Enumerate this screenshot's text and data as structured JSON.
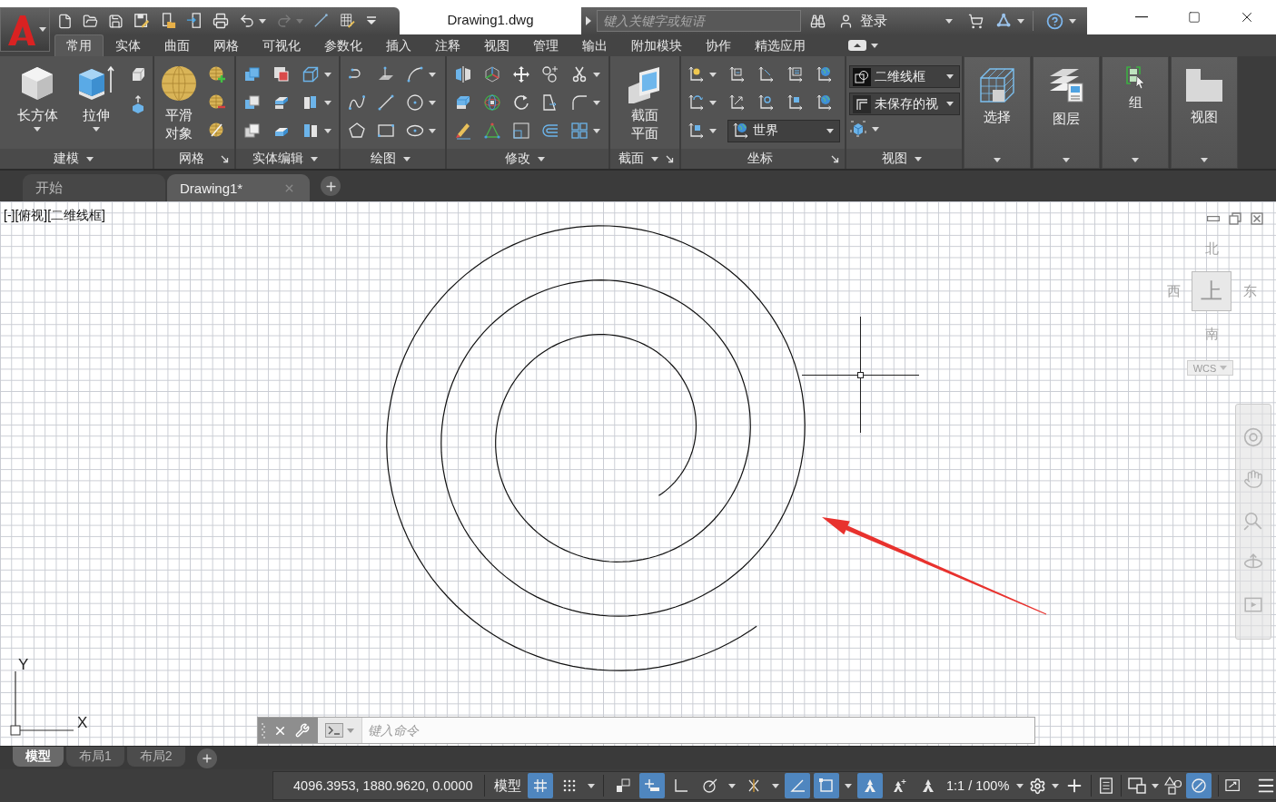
{
  "title_bar": {
    "title": "Drawing1.dwg",
    "search": {
      "placeholder": "键入关键字或短语"
    },
    "sign_in": "登录"
  },
  "quick_access": {
    "undo": {
      "disabled": false
    },
    "redo": {
      "disabled": true
    }
  },
  "ribbon_tabs": [
    {
      "label": "常用",
      "selected": true
    },
    {
      "label": "实体",
      "selected": false
    },
    {
      "label": "曲面",
      "selected": false
    },
    {
      "label": "网格",
      "selected": false
    },
    {
      "label": "可视化",
      "selected": false
    },
    {
      "label": "参数化",
      "selected": false
    },
    {
      "label": "插入",
      "selected": false
    },
    {
      "label": "注释",
      "selected": false
    },
    {
      "label": "视图",
      "selected": false
    },
    {
      "label": "管理",
      "selected": false
    },
    {
      "label": "输出",
      "selected": false
    },
    {
      "label": "附加模块",
      "selected": false
    },
    {
      "label": "协作",
      "selected": false
    },
    {
      "label": "精选应用",
      "selected": false
    }
  ],
  "ribbon_panels": [
    {
      "kind": "modeling",
      "title": "建模",
      "menu": true,
      "launcher": false,
      "buttons": [
        {
          "label": "长方体",
          "menu": true
        },
        {
          "label": "拉伸",
          "menu": true
        }
      ]
    },
    {
      "kind": "mesh",
      "title": "网格",
      "menu": false,
      "launcher": true,
      "buttons": [
        {
          "label": "平滑对象",
          "menu": false
        }
      ]
    },
    {
      "kind": "solids",
      "title": "实体编辑",
      "menu": true,
      "launcher": false
    },
    {
      "kind": "draw",
      "title": "绘图",
      "menu": true,
      "launcher": false
    },
    {
      "kind": "modify",
      "title": "修改",
      "menu": true,
      "launcher": false
    },
    {
      "kind": "section",
      "title": "截面",
      "menu": true,
      "launcher": true,
      "buttons": [
        {
          "label": "截面平面",
          "menu": false
        }
      ]
    },
    {
      "kind": "coordinates",
      "title": "坐标",
      "menu": false,
      "launcher": true,
      "dropdowns": [
        "世界"
      ]
    },
    {
      "kind": "view",
      "title": "视图",
      "menu": true,
      "launcher": false,
      "dropdowns": [
        "二维线框",
        "未保存的视"
      ]
    }
  ],
  "ribbon_buttons": [
    {
      "label": "选择",
      "menu": true
    },
    {
      "label": "图层",
      "menu": true
    },
    {
      "label": "组",
      "menu": true
    },
    {
      "label": "视图",
      "menu": true
    }
  ],
  "file_tabs": [
    {
      "label": "开始",
      "selected": false
    },
    {
      "label": "Drawing1*",
      "selected": true
    }
  ],
  "viewport": {
    "controls": [
      "[-]",
      "[俯视]",
      "[二维线框]"
    ],
    "viewcube": {
      "north": "北",
      "west": "西",
      "top": "上",
      "east": "东",
      "south": "南",
      "ucs": "WCS"
    },
    "axes": {
      "y": "Y",
      "x": "X"
    }
  },
  "command_line": {
    "placeholder": "键入命令"
  },
  "layout_tabs": [
    {
      "label": "模型",
      "selected": true
    },
    {
      "label": "布局1",
      "selected": false
    },
    {
      "label": "布局2",
      "selected": false
    }
  ],
  "status_bar": {
    "coordinates": "4096.3953, 1880.9620, 0.0000",
    "space": "模型",
    "scale": "1:1 / 100%",
    "toggles": [
      {
        "on": true
      },
      {
        "on": false
      },
      {
        "on": false
      },
      {
        "on": true
      },
      {
        "on": false
      },
      {
        "on": false
      },
      {
        "on": false
      },
      {
        "on": true
      },
      {
        "on": true
      },
      {
        "on": true
      },
      {
        "on": false
      },
      {
        "on": false
      },
      {
        "on": true
      }
    ]
  }
}
